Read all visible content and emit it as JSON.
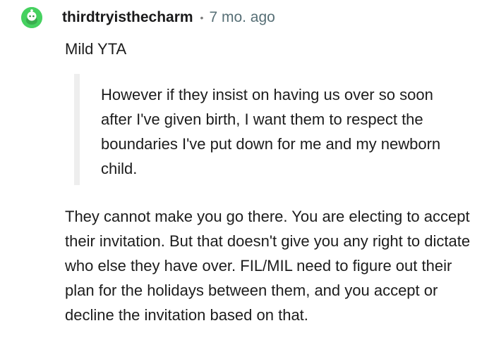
{
  "comment": {
    "avatar_icon": "snoo-avatar-icon",
    "avatar_color": "#46d160",
    "username": "thirdtryisthecharm",
    "separator": "•",
    "age": "7 mo. ago",
    "paragraph_1": "Mild YTA",
    "quote": "However if they insist on having us over so soon after I've given birth, I want them to respect the boundaries I've put down for me and my newborn child.",
    "paragraph_2": "They cannot make you go there. You are electing to accept their invitation. But that doesn't give you any right to dictate who else they have over. FIL/MIL need to figure out their plan for the holidays between them, and you accept or decline the invitation based on that."
  }
}
